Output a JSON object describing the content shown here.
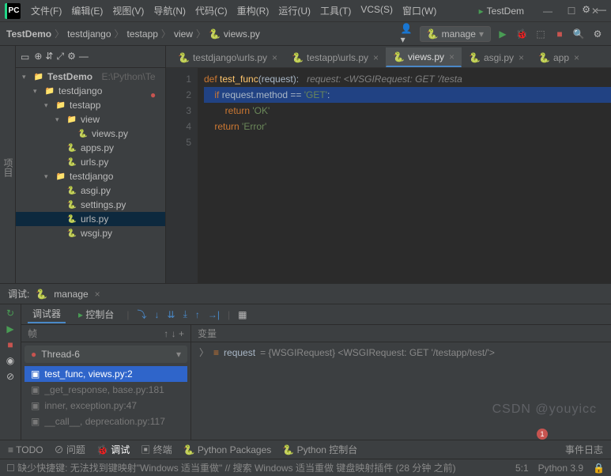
{
  "menu": {
    "file": "文件(F)",
    "edit": "编辑(E)",
    "view": "视图(V)",
    "nav": "导航(N)",
    "code": "代码(C)",
    "refactor": "重构(R)",
    "run": "运行(U)",
    "tools": "工具(T)",
    "vcs": "VCS(S)",
    "window": "窗口(W)"
  },
  "title_app": "TestDem",
  "breadcrumb": [
    "TestDemo",
    "testdjango",
    "testapp",
    "view",
    "views.py"
  ],
  "run_config": "manage",
  "left_gutter": "项目",
  "project": {
    "root": {
      "name": "TestDemo",
      "path": "E:\\Python\\Te"
    },
    "items": [
      {
        "indent": 1,
        "exp": true,
        "icon": "dir",
        "name": "testdjango"
      },
      {
        "indent": 2,
        "exp": true,
        "icon": "dir",
        "name": "testapp"
      },
      {
        "indent": 3,
        "exp": true,
        "icon": "dir",
        "name": "view"
      },
      {
        "indent": 4,
        "icon": "py",
        "name": "views.py",
        "sel": false
      },
      {
        "indent": 3,
        "icon": "py",
        "name": "apps.py"
      },
      {
        "indent": 3,
        "icon": "py",
        "name": "urls.py"
      },
      {
        "indent": 2,
        "exp": true,
        "icon": "dir",
        "name": "testdjango"
      },
      {
        "indent": 3,
        "icon": "py",
        "name": "asgi.py"
      },
      {
        "indent": 3,
        "icon": "py",
        "name": "settings.py"
      },
      {
        "indent": 3,
        "icon": "py",
        "name": "urls.py",
        "sel": true
      },
      {
        "indent": 3,
        "icon": "py",
        "name": "wsgi.py"
      }
    ]
  },
  "tabs": [
    {
      "label": "testdjango\\urls.py",
      "active": false
    },
    {
      "label": "testapp\\urls.py",
      "active": false
    },
    {
      "label": "views.py",
      "active": true
    },
    {
      "label": "asgi.py",
      "active": false
    },
    {
      "label": "app",
      "active": false
    }
  ],
  "code": {
    "lines": [
      "1",
      "2",
      "3",
      "4",
      "5"
    ],
    "l1": {
      "def": "def ",
      "fn": "test_func",
      "open": "(request):   ",
      "cmt": "request: <WSGIRequest: GET '/testa"
    },
    "l2": {
      "if": "if ",
      "expr": "request.method == ",
      "str": "'GET'",
      "colon": ":"
    },
    "l3": {
      "ret": "return ",
      "str": "'OK'"
    },
    "l4": {
      "ret": "return ",
      "str": "'Error'"
    }
  },
  "debug": {
    "title": "调试:",
    "config": "manage",
    "tabs": {
      "debugger": "调试器",
      "console": "控制台"
    },
    "frames_title": "帧",
    "vars_title": "变量",
    "thread": "Thread-6",
    "stack": [
      {
        "label": "test_func, views.py:2",
        "sel": true
      },
      {
        "label": "_get_response, base.py:181"
      },
      {
        "label": "inner, exception.py:47"
      },
      {
        "label": "__call__, deprecation.py:117"
      }
    ],
    "var": {
      "name": "request",
      "val": "= {WSGIRequest} <WSGIRequest: GET '/testapp/test/'>"
    }
  },
  "bottom_tabs": {
    "todo": "TODO",
    "problems": "问题",
    "debug": "调试",
    "terminal": "终端",
    "pypackages": "Python Packages",
    "pyconsole": "Python 控制台",
    "events": "事件日志"
  },
  "status": {
    "left": "缺少快捷键: 无法找到键映射\"Windows 适当重做\" // 搜索 Windows 适当重做 键盘映射插件 (28 分钟 之前)",
    "pos": "5:1",
    "interpreter": "Python 3.9"
  },
  "watermark": "CSDN @youyicc",
  "notif_count": "1"
}
